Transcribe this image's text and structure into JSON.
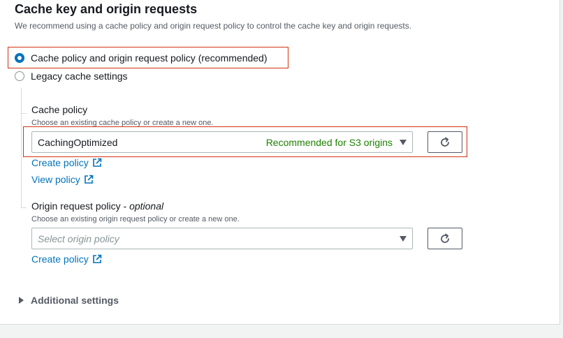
{
  "section": {
    "title": "Cache key and origin requests",
    "description": "We recommend using a cache policy and origin request policy to control the cache key and origin requests."
  },
  "options": {
    "recommended": {
      "label": "Cache policy and origin request policy (recommended)",
      "selected": true
    },
    "legacy": {
      "label": "Legacy cache settings",
      "selected": false
    }
  },
  "cache_policy": {
    "label": "Cache policy",
    "hint": "Choose an existing cache policy or create a new one.",
    "selected_value": "CachingOptimized",
    "tag": "Recommended for S3 origins",
    "create_link": "Create policy",
    "view_link": "View policy"
  },
  "origin_request_policy": {
    "label": "Origin request policy - ",
    "label_optional": "optional",
    "hint": "Choose an existing origin request policy or create a new one.",
    "placeholder": "Select origin policy",
    "create_link": "Create policy"
  },
  "additional_settings": {
    "label": "Additional settings"
  },
  "colors": {
    "link": "#0073bb",
    "highlight": "#d13212",
    "tag": "#1d8102",
    "radio_selected": "#0073bb"
  }
}
